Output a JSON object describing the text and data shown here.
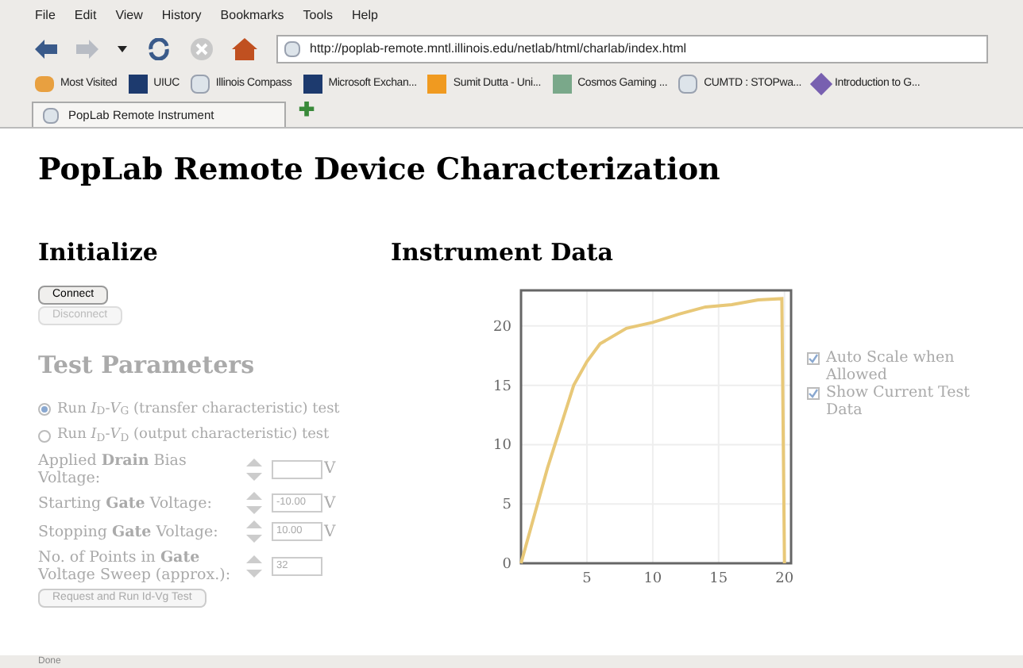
{
  "menu_bar": [
    "File",
    "Edit",
    "View",
    "History",
    "Bookmarks",
    "Tools",
    "Help"
  ],
  "address_bar": {
    "value": "http://poplab-remote.mntl.illinois.edu/netlab/html/charlab/index.html"
  },
  "bookmarks": [
    {
      "label": "Most Visited",
      "kind": "folder"
    },
    {
      "label": "UIUC",
      "kind": "site"
    },
    {
      "label": "Illinois Compass",
      "kind": "page"
    },
    {
      "label": "Microsoft Exchan...",
      "kind": "site"
    },
    {
      "label": "Sumit Dutta - Uni...",
      "kind": "orange"
    },
    {
      "label": "Cosmos Gaming ...",
      "kind": "green"
    },
    {
      "label": "CUMTD : STOPwa...",
      "kind": "page"
    },
    {
      "label": "Introduction to G...",
      "kind": "diamond"
    }
  ],
  "tabs": [
    {
      "label": "PopLab Remote Instrument",
      "selected": true
    }
  ],
  "new_tab_button": "✚",
  "page": {
    "title": "PopLab Remote Device Characterization",
    "initialize": {
      "heading": "Initialize",
      "buttons": [
        {
          "label": "Connect",
          "disabled": false
        },
        {
          "label": "Disconnect",
          "disabled": true
        }
      ]
    },
    "test_parameters": {
      "heading": "Test Parameters",
      "disabled": true,
      "tests": [
        {
          "label": "Run *I*$_{D}$-*V*$_{G}$ (transfer characteristic) test",
          "selected": true
        },
        {
          "label": "Run *I*$_{D}$-*V*$_{D}$ (output characteristic) test",
          "selected": false
        }
      ],
      "fields": [
        {
          "label": "Applied **Drain** Bias Voltage:",
          "unit": "V"
        },
        {
          "label": "Starting **Gate** Voltage:",
          "value": "-10.00",
          "unit": "V"
        },
        {
          "label": "Stopping **Gate** Voltage:",
          "value": "10.00",
          "unit": "V"
        },
        {
          "label": "No. of Points in **Gate** Voltage Sweep (approx.):",
          "value": "32"
        }
      ],
      "run_button": "Request and Run Id-Vg Test"
    },
    "instrument_data": {
      "heading": "Instrument Data",
      "chart_data": {
        "type": "line",
        "grid": true,
        "xlim": [
          0,
          20.5
        ],
        "ylim": [
          0,
          23
        ],
        "xticks": [
          5,
          10,
          15,
          20
        ],
        "yticks": [
          0,
          5,
          10,
          15,
          20
        ],
        "series": [
          {
            "color": "#e8c878",
            "values": [
              0,
              8,
              15,
              17,
              18.5,
              19.8,
              20.3,
              21,
              21.6,
              21.8,
              22.2,
              22.3,
              0
            ]
          }
        ],
        "x": [
          0,
          2,
          4,
          5,
          6,
          8,
          10,
          12,
          14,
          16,
          18,
          19.8,
          20
        ]
      },
      "options": [
        {
          "label": "Auto Scale when Allowed",
          "checked": true
        },
        {
          "label": "Show Current Test Data",
          "checked": true
        }
      ]
    }
  },
  "status_bar": "Done"
}
